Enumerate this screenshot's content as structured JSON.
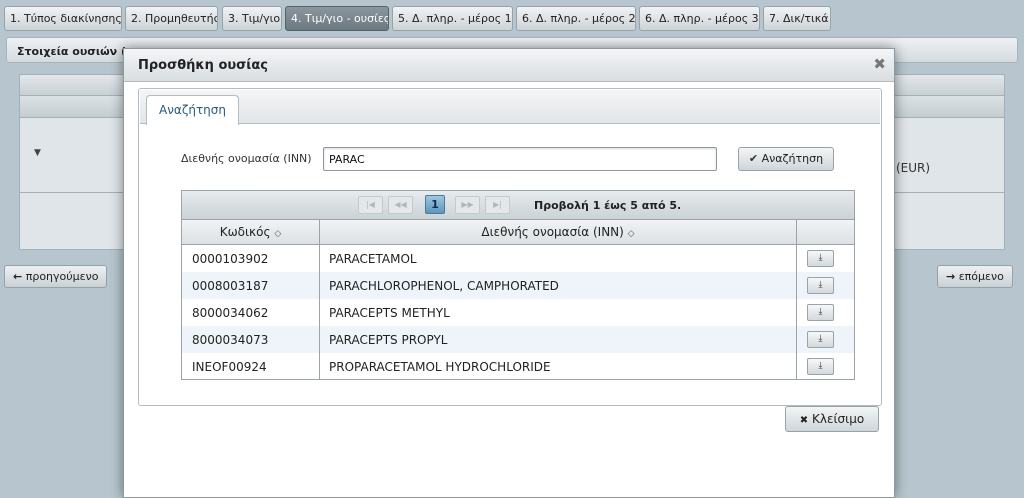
{
  "steps": [
    {
      "label": "1. Τύπος διακίνησης",
      "active": false
    },
    {
      "label": "2. Προμηθευτής",
      "active": false
    },
    {
      "label": "3. Τιμ/γιο",
      "active": false
    },
    {
      "label": "4. Τιμ/γιο - ουσίες",
      "active": true
    },
    {
      "label": "5. Δ. πληρ. - μέρος 1",
      "active": false
    },
    {
      "label": "6. Δ. πληρ. - μέρος 2",
      "active": false
    },
    {
      "label": "6. Δ. πληρ. - μέρος 3",
      "active": false
    },
    {
      "label": "7. Δικ/τικά",
      "active": false
    }
  ],
  "background": {
    "panel_title": "Στοιχεία ουσιών (ημ",
    "currency_label": "(EUR)",
    "prev_button": "προηγούμενο",
    "next_button": "επόμενο",
    "prev_icon": "arrow-left-icon",
    "next_icon": "arrow-right-icon"
  },
  "dialog": {
    "title": "Προσθήκη ουσίας",
    "close_icon": "close-icon",
    "tab_label": "Αναζήτηση",
    "inn_label": "Διεθνής ονομασία (INN)",
    "inn_value": "PARAC",
    "search_button": "Αναζήτηση",
    "search_icon": "check-icon",
    "close_button": "Κλείσιμο",
    "close_button_icon": "x-icon"
  },
  "pager": {
    "current_page": "1",
    "info": "Προβολή 1 έως 5 από 5."
  },
  "columns": {
    "code": "Κωδικός",
    "name": "Διεθνής ονομασία (INN)"
  },
  "rows": [
    {
      "code": "0000103902",
      "name": "PARACETAMOL"
    },
    {
      "code": "0008003187",
      "name": "PARACHLOROPHENOL, CAMPHORATED"
    },
    {
      "code": "8000034062",
      "name": "PARACEPTS METHYL"
    },
    {
      "code": "8000034073",
      "name": "PARACEPTS PROPYL"
    },
    {
      "code": "INEOF00924",
      "name": "PROPARACETAMOL HYDROCHLORIDE"
    }
  ],
  "colors": {
    "active_tab": "#6c7880",
    "page_background": "#b7c6ce",
    "alt_row": "#eef4fa",
    "tab_text": "#2a5a82"
  }
}
